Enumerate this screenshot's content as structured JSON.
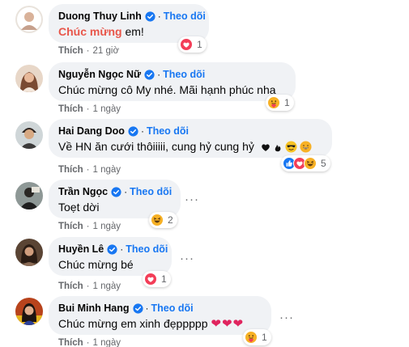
{
  "follow_label": "Theo dõi",
  "like_label": "Thích",
  "dot": "·",
  "comments": [
    {
      "name": "Duong Thuy Linh",
      "text_hl": "Chúc mừng",
      "text": " em!",
      "reaction_count": "1",
      "time": "21 giờ"
    },
    {
      "name": "Nguyễn Ngọc Nữ",
      "text": "Chúc mừng cô My nhé. Mãi hạnh phúc nha",
      "reaction_count": "1",
      "time": "1 ngày"
    },
    {
      "name": "Hai Dang Doo",
      "text": "Về HN ăn cưới thôiiiii, cung hỷ cung hỷ",
      "reaction_count": "5",
      "time": "1 ngày"
    },
    {
      "name": "Trần Ngọc",
      "text": "Toẹt dời",
      "reaction_count": "2",
      "time": "1 ngày"
    },
    {
      "name": "Huyền Lê",
      "text": "Chúc mừng bé",
      "reaction_count": "1",
      "time": "1 ngày"
    },
    {
      "name": "Bui Minh Hang",
      "text": "Chúc mừng em xinh đẹppppp",
      "text_hearts": "❤❤❤",
      "reaction_count": "1",
      "time": "1 ngày"
    }
  ],
  "more_label": "···",
  "colors": {
    "follow": "#1877f2",
    "bubble": "#f0f2f5",
    "meta": "#65676b",
    "highlight": "#e8564a"
  }
}
